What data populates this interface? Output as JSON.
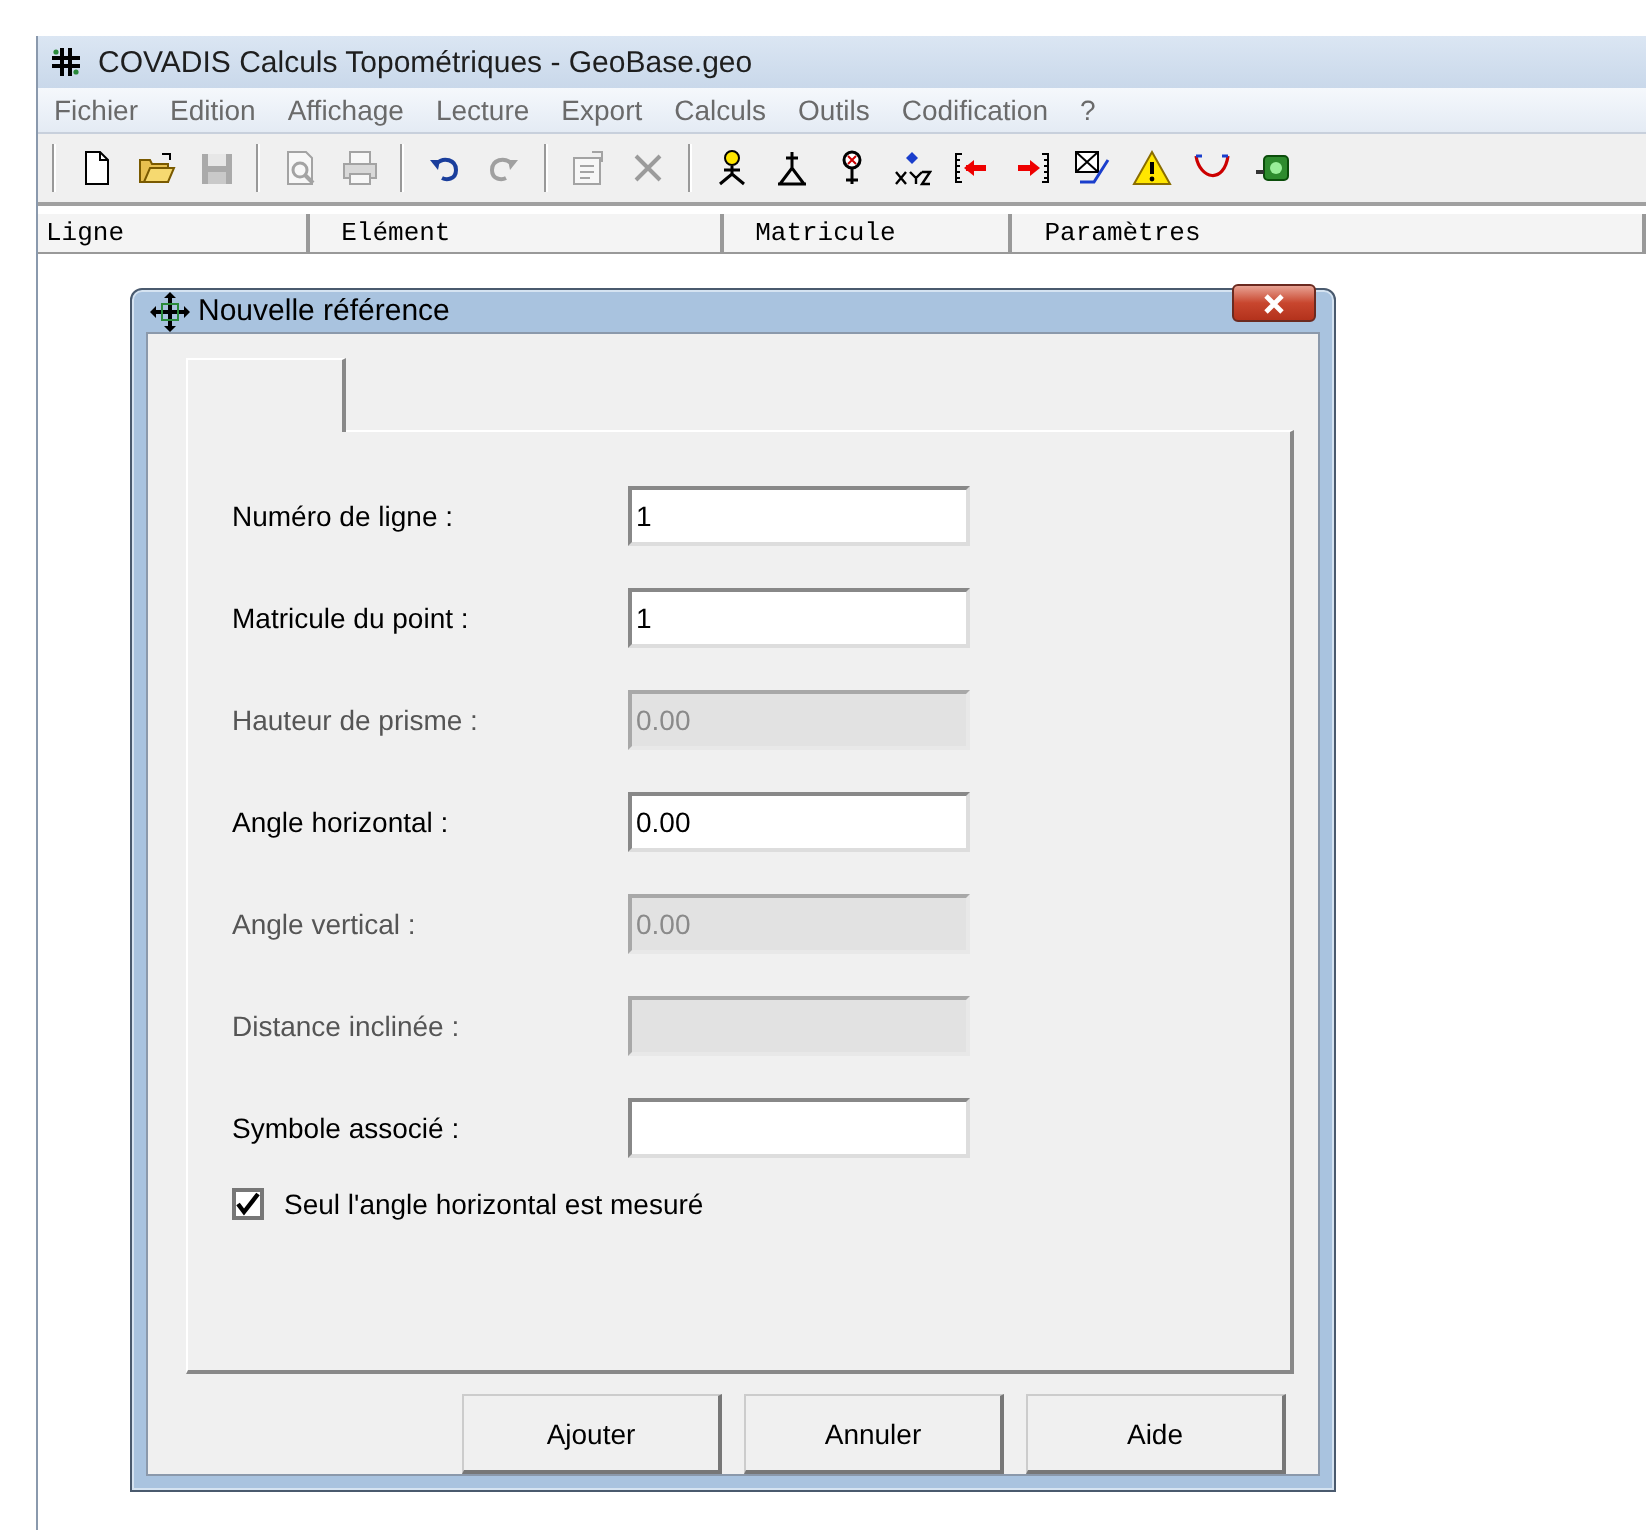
{
  "window": {
    "title": "COVADIS Calculs Topométriques - GeoBase.geo"
  },
  "menu": [
    "Fichier",
    "Edition",
    "Affichage",
    "Lecture",
    "Export",
    "Calculs",
    "Outils",
    "Codification",
    "?"
  ],
  "toolbar": [
    {
      "kind": "separator"
    },
    {
      "kind": "button",
      "disabled": false
    },
    {
      "kind": "button",
      "disabled": false
    },
    {
      "kind": "button",
      "disabled": true
    },
    {
      "kind": "separator"
    },
    {
      "kind": "button",
      "disabled": true
    },
    {
      "kind": "button",
      "disabled": true
    },
    {
      "kind": "separator"
    },
    {
      "kind": "button",
      "disabled": false
    },
    {
      "kind": "button",
      "disabled": true
    },
    {
      "kind": "separator"
    },
    {
      "kind": "button",
      "disabled": true
    },
    {
      "kind": "button",
      "disabled": true
    },
    {
      "kind": "separator"
    },
    {
      "kind": "button",
      "disabled": false
    },
    {
      "kind": "button",
      "disabled": false
    },
    {
      "kind": "button",
      "disabled": false
    },
    {
      "kind": "button",
      "disabled": false
    },
    {
      "kind": "button",
      "disabled": false
    },
    {
      "kind": "button",
      "disabled": false
    },
    {
      "kind": "button",
      "disabled": false
    },
    {
      "kind": "button",
      "disabled": false
    },
    {
      "kind": "button",
      "disabled": false
    },
    {
      "kind": "button",
      "disabled": false
    }
  ],
  "list": {
    "columns": [
      "Ligne",
      "Elément",
      "Matricule",
      "Paramètres"
    ]
  },
  "dialog": {
    "title": "Nouvelle référence",
    "tabs": [
      {
        "selected": true
      }
    ],
    "fields": [
      {
        "label": "Numéro de ligne :",
        "value": "1",
        "disabled": false
      },
      {
        "label": "Matricule du point :",
        "value": "1",
        "disabled": false
      },
      {
        "label": "Hauteur de prisme :",
        "value": "0.00",
        "disabled": true
      },
      {
        "label": "Angle horizontal :",
        "value": "0.00",
        "disabled": false
      },
      {
        "label": "Angle vertical :",
        "value": "0.00",
        "disabled": true
      },
      {
        "label": "Distance inclinée :",
        "disabled": true
      },
      {
        "label": "Symbole associé :",
        "disabled": false
      }
    ],
    "checkbox": {
      "label": "Seul l'angle horizontal est mesuré",
      "checked": true
    },
    "buttons": [
      "Ajouter",
      "Annuler",
      "Aide"
    ]
  }
}
